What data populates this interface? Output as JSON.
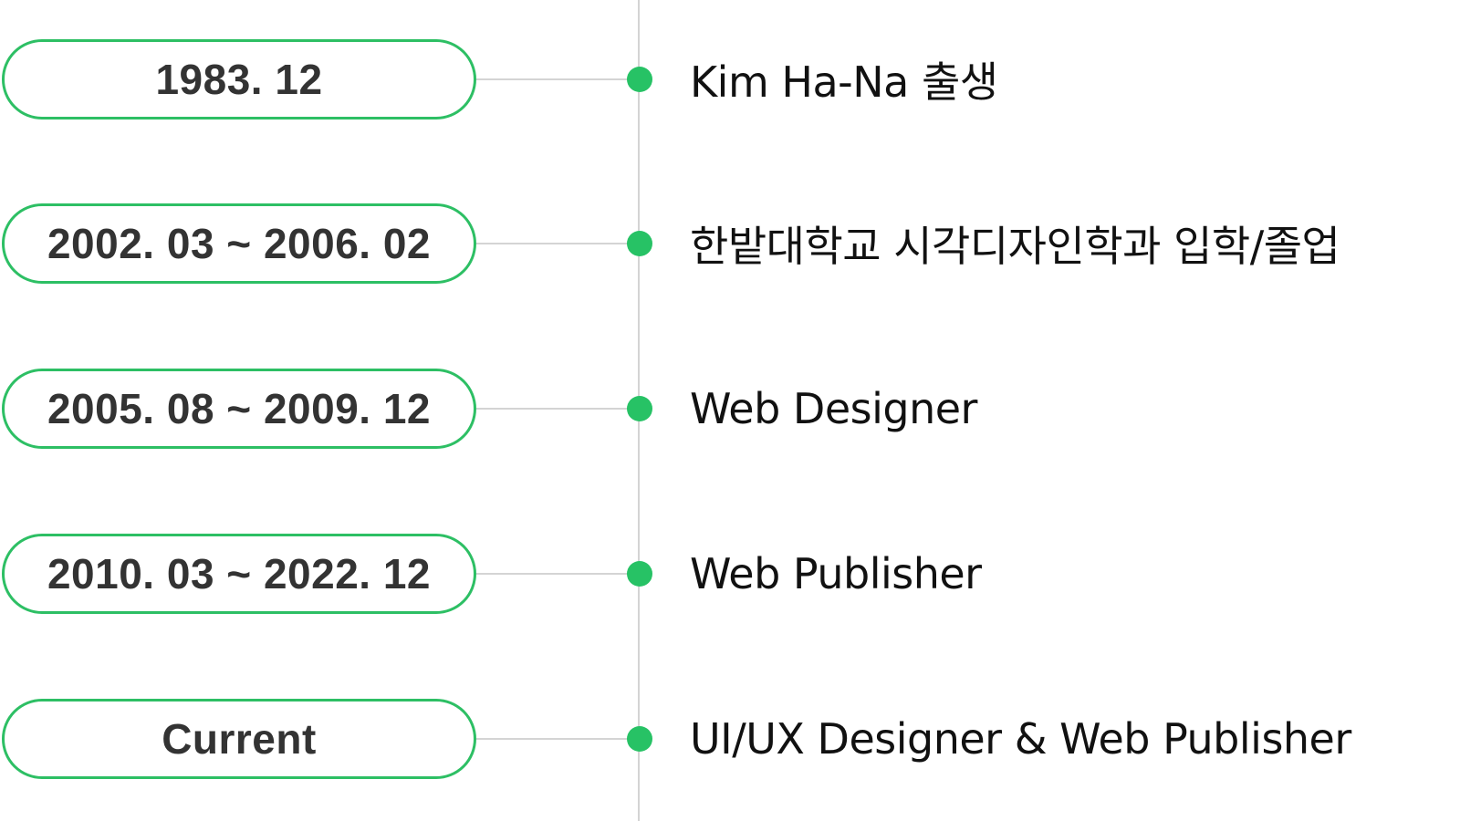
{
  "colors": {
    "accent": "#2dbf64",
    "dot": "#27c265",
    "line": "#d4d4d4",
    "date_text": "#333333",
    "event_text": "#111111"
  },
  "timeline": {
    "items": [
      {
        "date": "1983. 12",
        "event": "Kim Ha-Na 출생"
      },
      {
        "date": "2002. 03 ~ 2006. 02",
        "event": "한밭대학교 시각디자인학과 입학/졸업"
      },
      {
        "date": "2005. 08 ~ 2009. 12",
        "event": "Web Designer"
      },
      {
        "date": "2010. 03 ~ 2022. 12",
        "event": "Web Publisher"
      },
      {
        "date": "Current",
        "event": "UI/UX Designer & Web Publisher"
      }
    ]
  }
}
